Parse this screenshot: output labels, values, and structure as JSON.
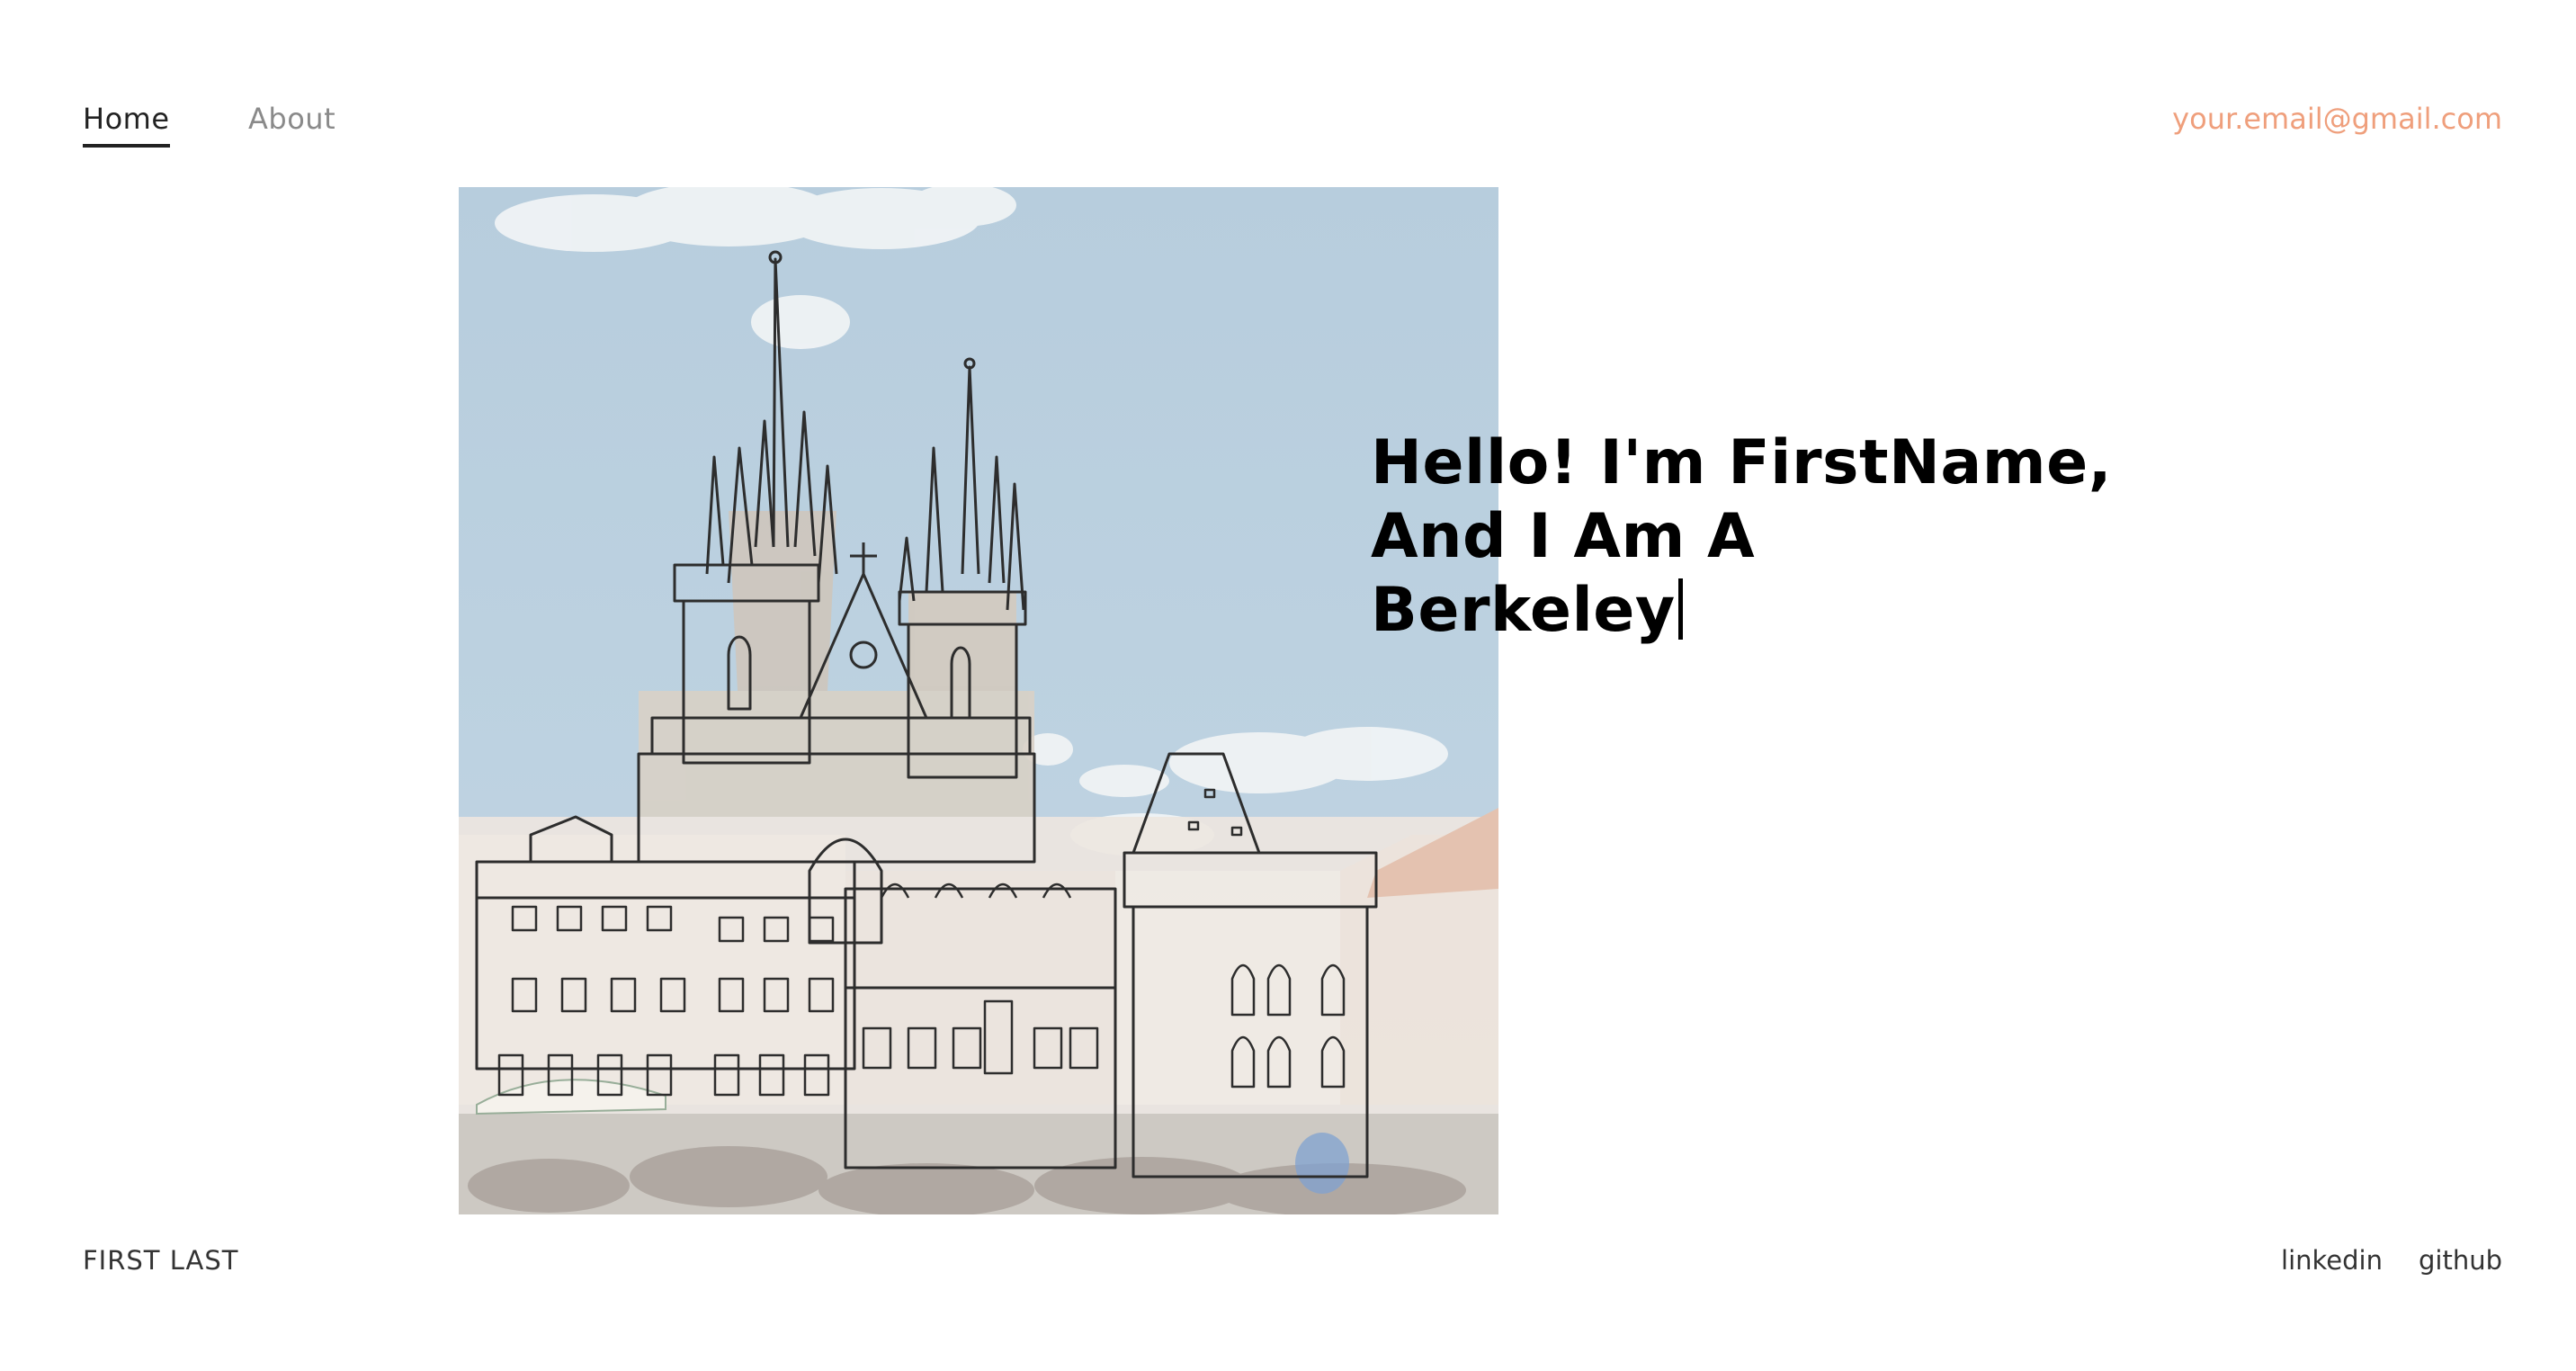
{
  "nav": {
    "home_label": "Home",
    "about_label": "About",
    "email": "your.email@gmail.com"
  },
  "hero": {
    "headline_lines": [
      "Hello! I'm FirstName,",
      "And I Am A",
      "Berkeley"
    ]
  },
  "footer": {
    "name": "FIRST LAST",
    "links": [
      "linkedin",
      "github"
    ]
  },
  "colors": {
    "accent": "#ef9f7c",
    "text": "#222222",
    "muted": "#8a8a8a",
    "sky": "#b5ccdc"
  },
  "icons": {
    "text_cursor": "text-cursor-icon"
  }
}
